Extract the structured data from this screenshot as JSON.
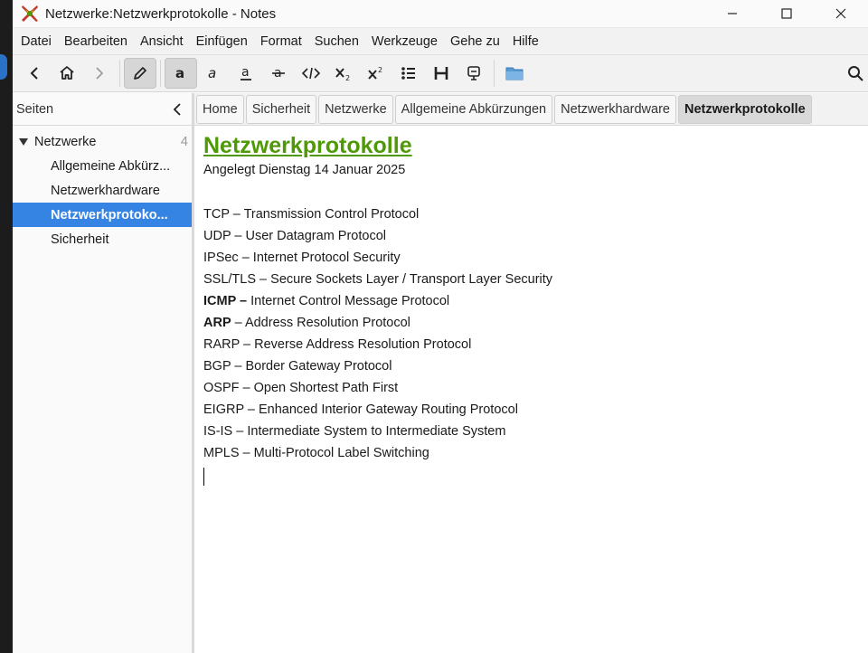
{
  "window": {
    "title": "Netzwerke:Netzwerkprotokolle - Notes"
  },
  "menu": [
    "Datei",
    "Bearbeiten",
    "Ansicht",
    "Einfügen",
    "Format",
    "Suchen",
    "Werkzeuge",
    "Gehe zu",
    "Hilfe"
  ],
  "toolbar": {
    "icons": [
      "back-icon",
      "home-icon",
      "forward-icon",
      "edit-icon",
      "bold-icon",
      "italic-icon",
      "underline-icon",
      "strikethrough-icon",
      "code-icon",
      "subscript-icon",
      "superscript-icon",
      "bulleted-list-icon",
      "heading-icon",
      "verbatim-icon",
      "attach-file-icon",
      "search-icon"
    ]
  },
  "sidebar": {
    "title": "Seiten",
    "root": {
      "label": "Netzwerke",
      "count": "4"
    },
    "children": [
      {
        "label": "Allgemeine Abkürz..."
      },
      {
        "label": "Netzwerkhardware"
      },
      {
        "label": "Netzwerkprotoko...",
        "selected": true
      },
      {
        "label": "Sicherheit"
      }
    ]
  },
  "tabs": [
    "Home",
    "Sicherheit",
    "Netzwerke",
    "Allgemeine Abkürzungen",
    "Netzwerkhardware",
    "Netzwerkprotokolle"
  ],
  "page": {
    "heading": "Netzwerkprotokolle",
    "created": "Angelegt Dienstag 14 Januar 2025",
    "lines": [
      {
        "bold": "",
        "text": "TCP – Transmission Control Protocol"
      },
      {
        "bold": "",
        "text": "UDP – User Datagram Protocol"
      },
      {
        "bold": "",
        "text": "IPSec – Internet Protocol Security"
      },
      {
        "bold": "",
        "text": "SSL/TLS – Secure Sockets Layer / Transport Layer Security"
      },
      {
        "bold": "ICMP –",
        "text": " Internet Control Message Protocol"
      },
      {
        "bold": "ARP",
        "text": " – Address Resolution Protocol"
      },
      {
        "bold": "",
        "text": "RARP – Reverse Address Resolution Protocol"
      },
      {
        "bold": "",
        "text": "BGP – Border Gateway Protocol"
      },
      {
        "bold": "",
        "text": "OSPF – Open Shortest Path First"
      },
      {
        "bold": "",
        "text": "EIGRP – Enhanced Interior Gateway Routing Protocol"
      },
      {
        "bold": "",
        "text": "IS-IS – Intermediate System to Intermediate System"
      },
      {
        "bold": "",
        "text": "MPLS – Multi-Protocol Label Switching"
      }
    ]
  },
  "colors": {
    "heading": "#4e9a06",
    "selection": "#3584e4"
  }
}
